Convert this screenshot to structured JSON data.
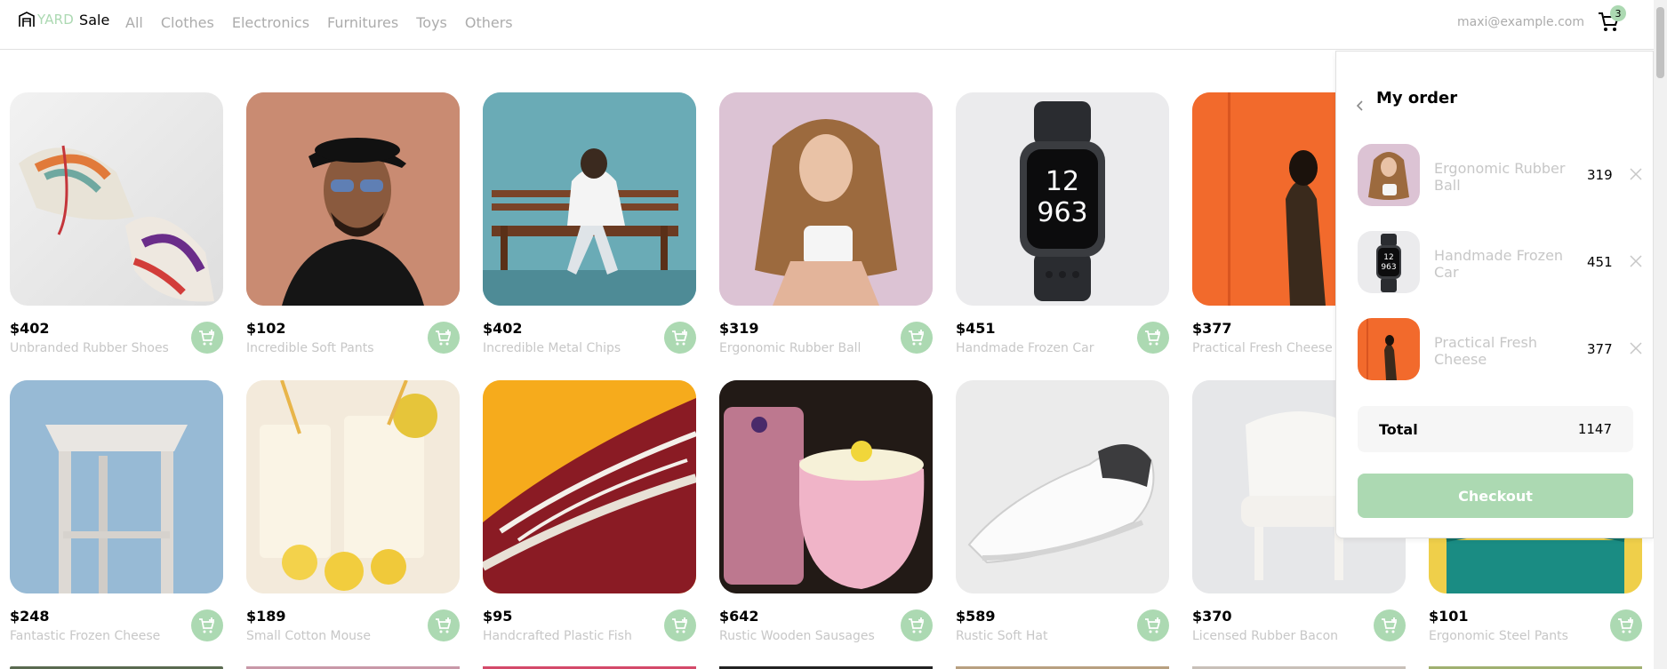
{
  "brand": {
    "part1": "YARD",
    "part2": "Sale"
  },
  "nav": [
    "All",
    "Clothes",
    "Electronics",
    "Furnitures",
    "Toys",
    "Others"
  ],
  "user_email": "maxi@example.com",
  "cart_count": "3",
  "products": [
    {
      "price": "$402",
      "name": "Unbranded Rubber Shoes"
    },
    {
      "price": "$102",
      "name": "Incredible Soft Pants"
    },
    {
      "price": "$402",
      "name": "Incredible Metal Chips"
    },
    {
      "price": "$319",
      "name": "Ergonomic Rubber Ball"
    },
    {
      "price": "$451",
      "name": "Handmade Frozen Car"
    },
    {
      "price": "$377",
      "name": "Practical Fresh Cheese"
    },
    {
      "price": "",
      "name": ""
    },
    {
      "price": "$248",
      "name": "Fantastic Frozen Cheese"
    },
    {
      "price": "$189",
      "name": "Small Cotton Mouse"
    },
    {
      "price": "$95",
      "name": "Handcrafted Plastic Fish"
    },
    {
      "price": "$642",
      "name": "Rustic Wooden Sausages"
    },
    {
      "price": "$589",
      "name": "Rustic Soft Hat"
    },
    {
      "price": "$370",
      "name": "Licensed Rubber Bacon"
    },
    {
      "price": "$101",
      "name": "Ergonomic Steel Pants"
    }
  ],
  "order": {
    "title": "My order",
    "items": [
      {
        "name": "Ergonomic Rubber Ball",
        "price": "319"
      },
      {
        "name": "Handmade Frozen Car",
        "price": "451"
      },
      {
        "name": "Practical Fresh Cheese",
        "price": "377"
      }
    ],
    "total_label": "Total",
    "total_value": "1147",
    "checkout_label": "Checkout"
  },
  "colors": {
    "accent": "#acd9b2",
    "muted_text": "#c7c7c7",
    "nav_text": "#acacac"
  }
}
